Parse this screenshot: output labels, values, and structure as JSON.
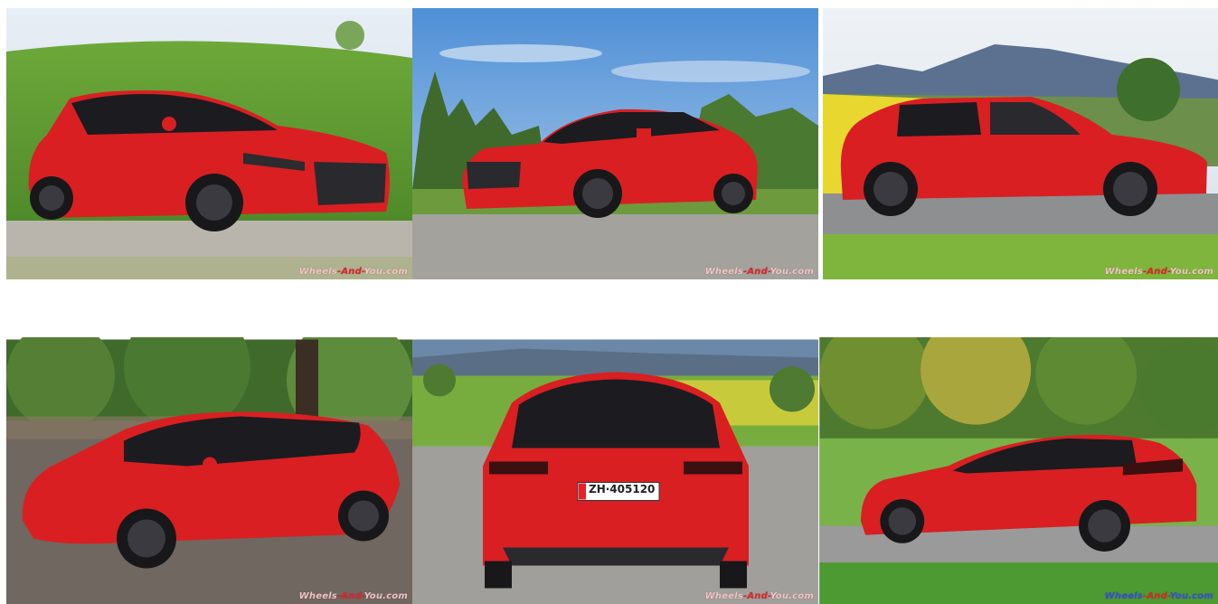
{
  "gallery": {
    "photos": [
      {
        "subject": "red-hatchback-front-three-quarter-on-grass",
        "watermark": {
          "part1": "Wheels",
          "sep1": "-",
          "part2": "And",
          "sep2": "-",
          "part3": "You.com"
        }
      },
      {
        "subject": "red-hatchback-front-three-quarter-trees",
        "watermark": {
          "part1": "Wheels",
          "sep1": "-",
          "part2": "And",
          "sep2": "-",
          "part3": "You.com"
        }
      },
      {
        "subject": "red-hatchback-side-profile-mountains",
        "watermark": {
          "part1": "Wheels",
          "sep1": "-",
          "part2": "And",
          "sep2": "-",
          "part3": "You.com"
        }
      },
      {
        "subject": "red-hatchback-high-front-three-quarter-forest",
        "watermark": {
          "part1": "Wheels",
          "sep1": "-",
          "part2": "And",
          "sep2": "-",
          "part3": "You.com"
        }
      },
      {
        "subject": "red-hatchback-rear-view",
        "plate": "ZH·405120",
        "watermark": {
          "part1": "Wheels",
          "sep1": "-",
          "part2": "And",
          "sep2": "-",
          "part3": "You.com"
        }
      },
      {
        "subject": "red-hatchback-rear-three-quarter-field",
        "watermark": {
          "part1": "Wheels",
          "sep1": "-",
          "part2": "And",
          "sep2": "-",
          "part3": "You.com"
        }
      }
    ]
  },
  "colors": {
    "car_red": "#d91f22",
    "watermark_main": "#f3c4c4",
    "watermark_accent": "#e3232b",
    "watermark_blue": "#3a4fd8"
  }
}
